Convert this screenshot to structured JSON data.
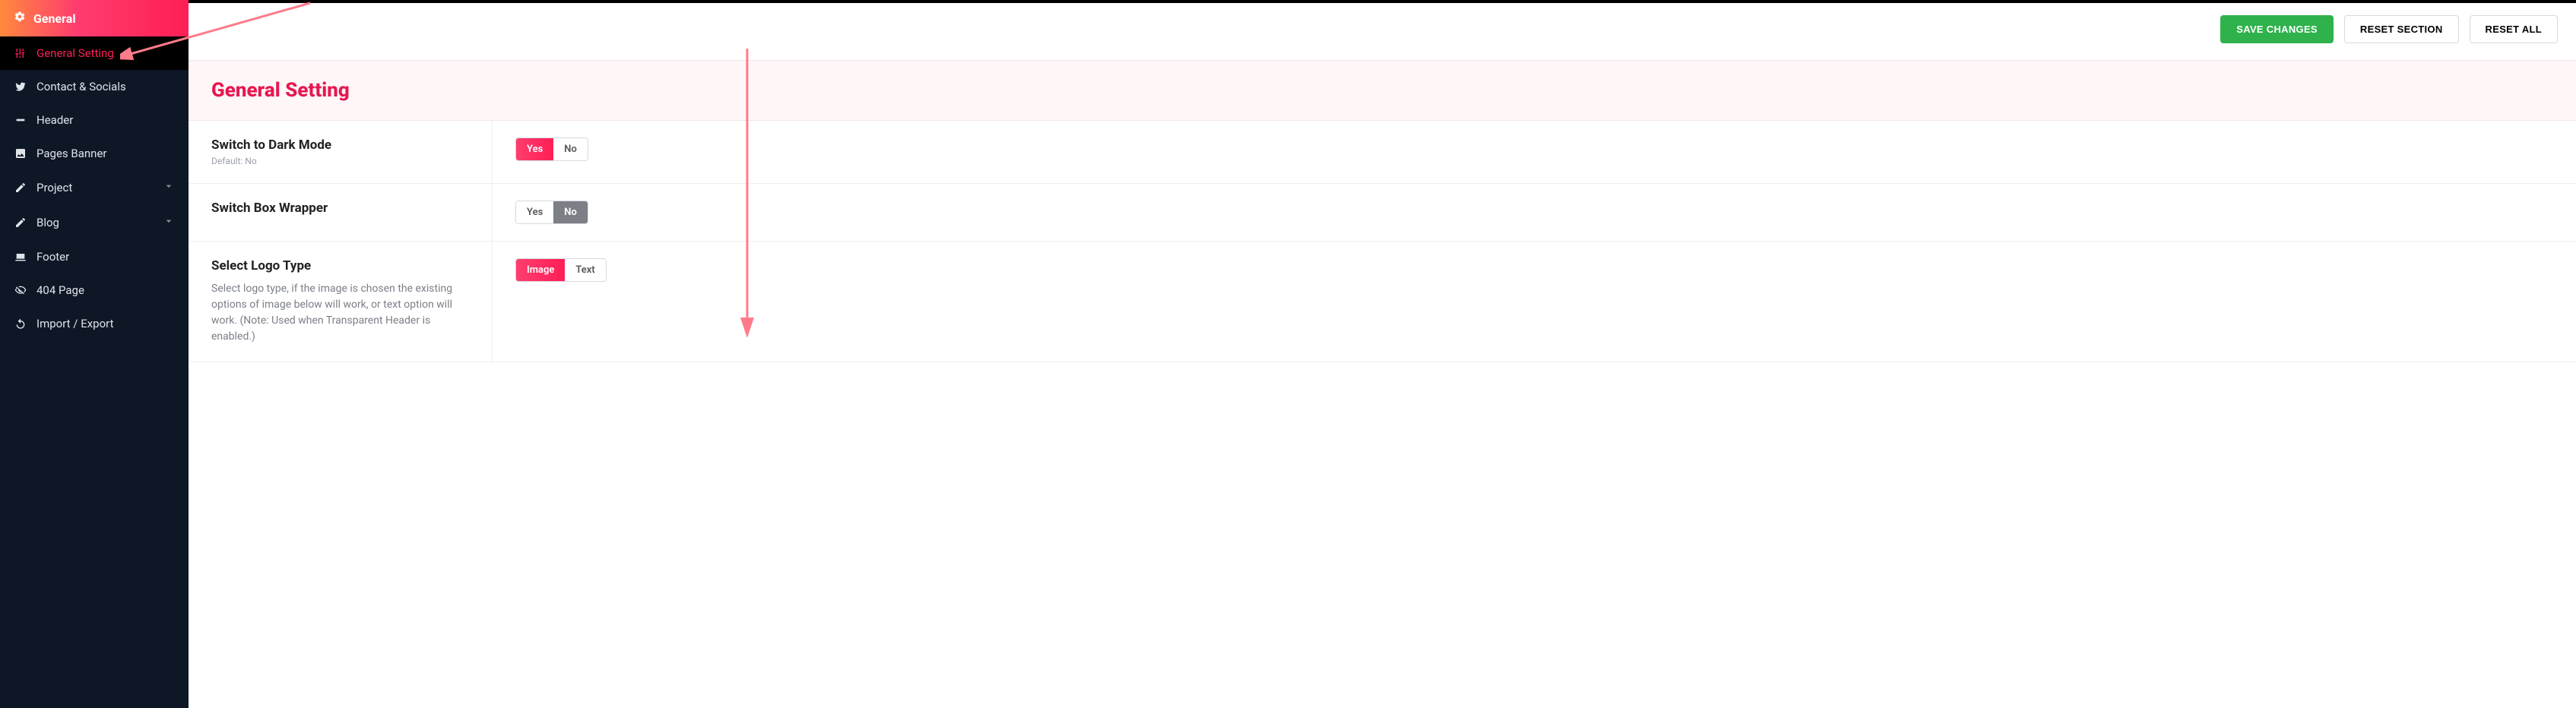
{
  "sidebar": {
    "header": {
      "label": "General"
    },
    "items": [
      {
        "label": "General Setting",
        "icon": "sliders-icon",
        "active": true,
        "expandable": false
      },
      {
        "label": "Contact & Socials",
        "icon": "twitter-icon",
        "active": false,
        "expandable": false
      },
      {
        "label": "Header",
        "icon": "minus-icon",
        "active": false,
        "expandable": false
      },
      {
        "label": "Pages Banner",
        "icon": "image-icon",
        "active": false,
        "expandable": false
      },
      {
        "label": "Project",
        "icon": "edit-icon",
        "active": false,
        "expandable": true
      },
      {
        "label": "Blog",
        "icon": "edit-icon",
        "active": false,
        "expandable": true
      },
      {
        "label": "Footer",
        "icon": "laptop-icon",
        "active": false,
        "expandable": false
      },
      {
        "label": "404 Page",
        "icon": "eye-off-icon",
        "active": false,
        "expandable": false
      },
      {
        "label": "Import / Export",
        "icon": "refresh-icon",
        "active": false,
        "expandable": false
      }
    ]
  },
  "topbar": {
    "save_label": "SAVE CHANGES",
    "reset_section_label": "RESET SECTION",
    "reset_all_label": "RESET ALL"
  },
  "section": {
    "title": "General Setting"
  },
  "settings": {
    "dark_mode": {
      "title": "Switch to Dark Mode",
      "hint": "Default: No",
      "yes": "Yes",
      "no": "No",
      "value": "Yes"
    },
    "box_wrapper": {
      "title": "Switch Box Wrapper",
      "yes": "Yes",
      "no": "No",
      "value": "No"
    },
    "logo_type": {
      "title": "Select Logo Type",
      "desc": "Select logo type, if the image is chosen the existing options of image below will work, or text option will work. (Note: Used when Transparent Header is enabled.)",
      "image": "Image",
      "text": "Text",
      "value": "Image"
    }
  },
  "colors": {
    "accent": "#ff1e56",
    "save_button": "#2fb24c"
  }
}
